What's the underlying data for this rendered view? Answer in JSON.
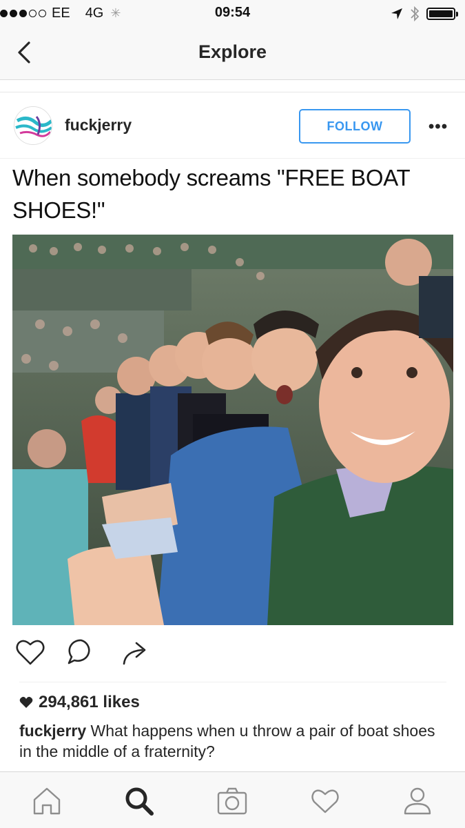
{
  "status_bar": {
    "carrier": "EE",
    "network": "4G",
    "time": "09:54",
    "signal_strength": 3,
    "signal_max": 5,
    "battery_level": 1.0
  },
  "nav": {
    "title": "Explore",
    "back_icon": "chevron-left-icon"
  },
  "post": {
    "username": "fuckjerry",
    "follow_label": "FOLLOW",
    "more_label": "•••",
    "meme_caption": "When somebody screams \"FREE BOAT SHOES!\"",
    "likes": "294,861 likes",
    "caption_user": "fuckjerry",
    "caption_text": " What happens when u throw a pair of boat shoes in the middle of a fraternity?"
  },
  "actions": [
    "heart-icon",
    "comment-icon",
    "share-icon"
  ],
  "tabs": [
    "home-icon",
    "search-icon",
    "camera-icon",
    "activity-heart-icon",
    "profile-icon"
  ],
  "colors": {
    "accent": "#3897f0",
    "bar_bg": "#f8f8f8",
    "text": "#262626"
  }
}
